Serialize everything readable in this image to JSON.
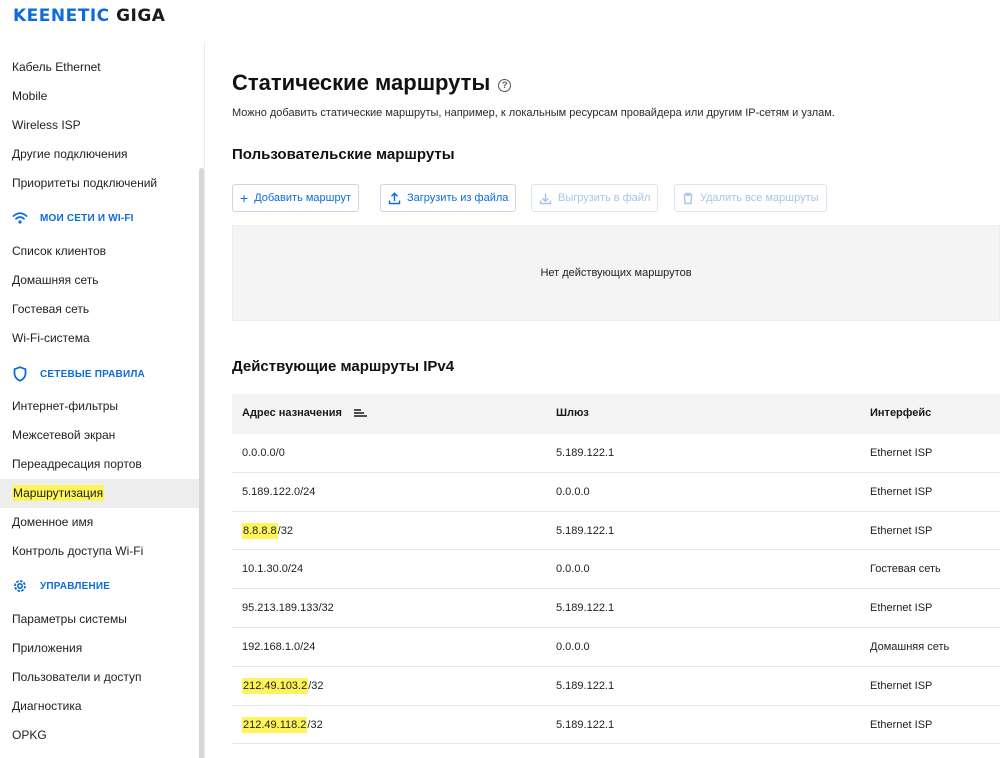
{
  "header": {
    "brand": "KEENETIC",
    "model": "GIGA"
  },
  "sidebar": {
    "items_top": [
      "Кабель Ethernet",
      "Mobile",
      "Wireless ISP",
      "Другие подключения",
      "Приоритеты подключений"
    ],
    "section_wifi": "МОИ СЕТИ И WI-FI",
    "items_wifi": [
      "Список клиентов",
      "Домашняя сеть",
      "Гостевая сеть",
      "Wi-Fi-система"
    ],
    "section_rules": "СЕТЕВЫЕ ПРАВИЛА",
    "items_rules": [
      "Интернет-фильтры",
      "Межсетевой экран",
      "Переадресация портов",
      "Маршрутизация",
      "Доменное имя",
      "Контроль доступа Wi-Fi"
    ],
    "section_manage": "УПРАВЛЕНИЕ",
    "items_manage": [
      "Параметры системы",
      "Приложения",
      "Пользователи и доступ",
      "Диагностика",
      "OPKG"
    ]
  },
  "main": {
    "title": "Статические маршруты",
    "description": "Можно добавить статические маршруты, например, к локальным ресурсам провайдера или другим IP-сетям и узлам.",
    "user_routes_title": "Пользовательские маршруты",
    "buttons": {
      "add": "Добавить маршрут",
      "upload": "Загрузить из файла",
      "download": "Выгрузить в файл",
      "delete_all": "Удалить все маршруты"
    },
    "empty_text": "Нет действующих маршрутов",
    "active_routes_title": "Действующие маршруты IPv4",
    "table": {
      "headers": [
        "Адрес назначения",
        "Шлюз",
        "Интерфейс"
      ],
      "rows": [
        {
          "dest_hl": "",
          "dest": "0.0.0.0/0",
          "gw": "5.189.122.1",
          "iface": "Ethernet ISP"
        },
        {
          "dest_hl": "",
          "dest": "5.189.122.0/24",
          "gw": "0.0.0.0",
          "iface": "Ethernet ISP"
        },
        {
          "dest_hl": "8.8.8.8",
          "dest": "/32",
          "gw": "5.189.122.1",
          "iface": "Ethernet ISP"
        },
        {
          "dest_hl": "",
          "dest": "10.1.30.0/24",
          "gw": "0.0.0.0",
          "iface": "Гостевая сеть"
        },
        {
          "dest_hl": "",
          "dest": "95.213.189.133/32",
          "gw": "5.189.122.1",
          "iface": "Ethernet ISP"
        },
        {
          "dest_hl": "",
          "dest": "192.168.1.0/24",
          "gw": "0.0.0.0",
          "iface": "Домашняя сеть"
        },
        {
          "dest_hl": "212.49.103.2",
          "dest": "/32",
          "gw": "5.189.122.1",
          "iface": "Ethernet ISP"
        },
        {
          "dest_hl": "212.49.118.2",
          "dest": "/32",
          "gw": "5.189.122.1",
          "iface": "Ethernet ISP"
        }
      ]
    }
  },
  "colors": {
    "accent": "#0c6cd8",
    "highlight": "#fff45a"
  }
}
